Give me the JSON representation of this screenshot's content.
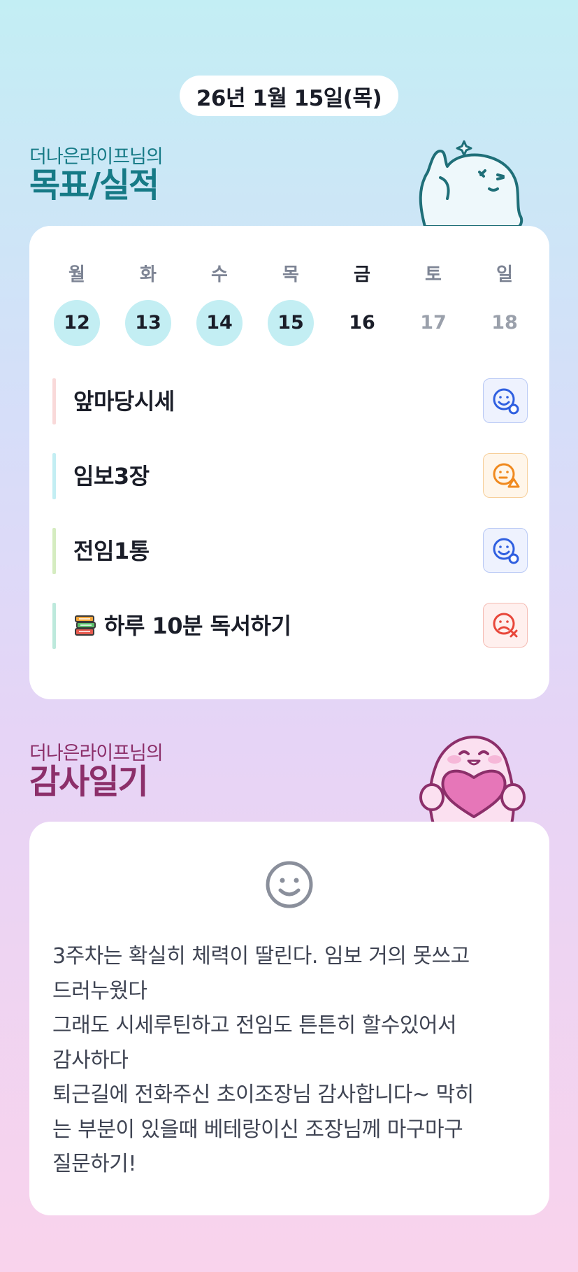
{
  "header": {
    "date": "26년 1월 15일(목)"
  },
  "goals_section": {
    "subtitle": "더나은라이프님의",
    "title": "목표/실적"
  },
  "week": [
    {
      "day": "월",
      "date": "12",
      "state": "done"
    },
    {
      "day": "화",
      "date": "13",
      "state": "done"
    },
    {
      "day": "수",
      "date": "14",
      "state": "done"
    },
    {
      "day": "목",
      "date": "15",
      "state": "done"
    },
    {
      "day": "금",
      "date": "16",
      "state": "today"
    },
    {
      "day": "토",
      "date": "17",
      "state": "future"
    },
    {
      "day": "일",
      "date": "18",
      "state": "future"
    }
  ],
  "goals": [
    {
      "label": "앞마당시세",
      "bar_color": "#f9d9d9",
      "status": "achieved-icon",
      "status_color": "#2f5fe0",
      "status_bg": "#eef2fe",
      "status_border": "#b9c9f5"
    },
    {
      "label": "임보3장",
      "bar_color": "#c3eef3",
      "status": "partial-icon",
      "status_color": "#f08a1f",
      "status_bg": "#fff6ea",
      "status_border": "#f7cf9a"
    },
    {
      "label": "전임1통",
      "bar_color": "#d5ecc0",
      "status": "achieved-icon",
      "status_color": "#2f5fe0",
      "status_bg": "#eef2fe",
      "status_border": "#b9c9f5"
    },
    {
      "label": "하루 10분 독서하기",
      "bar_color": "#bde9dc",
      "status": "failed-icon",
      "status_color": "#e8473a",
      "status_bg": "#fff0ee",
      "status_border": "#f5bcb4",
      "icon": "books-icon"
    }
  ],
  "thanks_section": {
    "subtitle": "더나은라이프님의",
    "title": "감사일기"
  },
  "diary": {
    "mood": "smile-icon",
    "text": "3주차는 확실히 체력이 딸린다. 임보 거의 못쓰고\n드러누웠다\n그래도 시세루틴하고 전임도 튼튼히 할수있어서\n감사하다\n퇴근길에 전화주신 초이조장님 감사합니다~ 막히\n는 부분이 있을때 베테랑이신 조장님께 마구마구\n질문하기!"
  }
}
